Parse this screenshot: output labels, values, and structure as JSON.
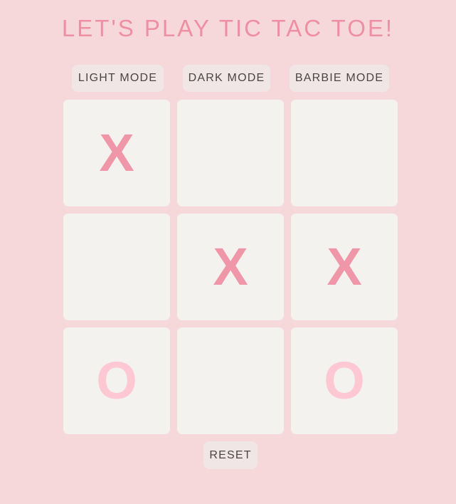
{
  "title": "LET'S PLAY TIC TAC TOE!",
  "modes": {
    "light": "LIGHT MODE",
    "dark": "DARK MODE",
    "barbie": "BARBIE MODE"
  },
  "board": {
    "cells": [
      "X",
      "",
      "",
      "",
      "X",
      "X",
      "O",
      "",
      "O"
    ]
  },
  "reset_label": "RESET",
  "colors": {
    "background": "#f6d8db",
    "title": "#ef8fa3",
    "cell": "#f3f2ef",
    "x_mark": "#ef97a9",
    "o_mark": "#fdc8d2",
    "button_bg": "#f1e6e6",
    "button_text": "#4c4444"
  }
}
